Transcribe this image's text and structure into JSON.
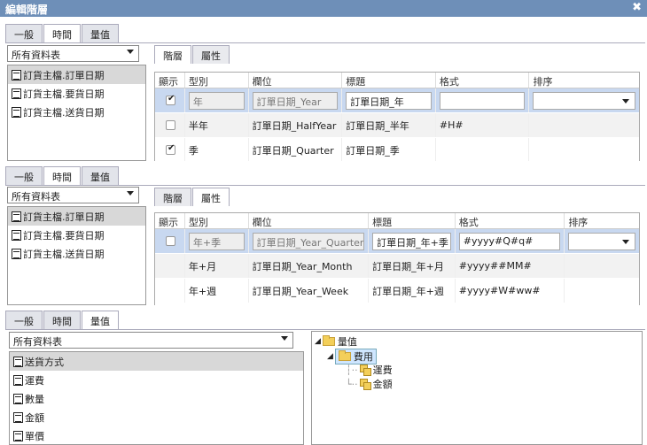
{
  "dialog": {
    "title": "編輯階層",
    "close": "✖"
  },
  "tabs": [
    "一般",
    "時間",
    "量值"
  ],
  "source_select": "所有資料表",
  "panel1": {
    "tables": [
      "訂貨主檔.訂單日期",
      "訂貨主檔.要貨日期",
      "訂貨主檔.送貨日期"
    ],
    "subtabs": [
      "階層",
      "屬性"
    ],
    "headers": [
      "顯示",
      "型別",
      "欄位",
      "標題",
      "格式",
      "排序"
    ],
    "rows": [
      {
        "checked": true,
        "type": "年",
        "field": "訂單日期_Year",
        "title": "訂單日期_年",
        "format": "",
        "sort": ""
      },
      {
        "checked": false,
        "type": "半年",
        "field": "訂單日期_HalfYear",
        "title": "訂單日期_半年",
        "format": "#H#",
        "sort": ""
      },
      {
        "checked": true,
        "type": "季",
        "field": "訂單日期_Quarter",
        "title": "訂單日期_季",
        "format": "",
        "sort": ""
      }
    ]
  },
  "panel2": {
    "tables": [
      "訂貨主檔.訂單日期",
      "訂貨主檔.要貨日期",
      "訂貨主檔.送貨日期"
    ],
    "subtabs": [
      "階層",
      "屬性"
    ],
    "headers": [
      "顯示",
      "型別",
      "欄位",
      "標題",
      "格式",
      "排序"
    ],
    "rows": [
      {
        "checked": false,
        "type": "年+季",
        "field": "訂單日期_Year_Quarter",
        "title": "訂單日期_年+季",
        "format": "#yyyy#Q#q#",
        "sort": ""
      },
      {
        "type": "年+月",
        "field": "訂單日期_Year_Month",
        "title": "訂單日期_年+月",
        "format": "#yyyy##MM#",
        "sort": ""
      },
      {
        "type": "年+週",
        "field": "訂單日期_Year_Week",
        "title": "訂單日期_年+週",
        "format": "#yyyy#W#ww#",
        "sort": ""
      }
    ]
  },
  "panel3": {
    "fields": [
      "送貨方式",
      "運費",
      "數量",
      "金額",
      "單價"
    ],
    "tree": {
      "root": "量值",
      "group": "費用",
      "leaves": [
        "運費",
        "金額"
      ]
    }
  }
}
